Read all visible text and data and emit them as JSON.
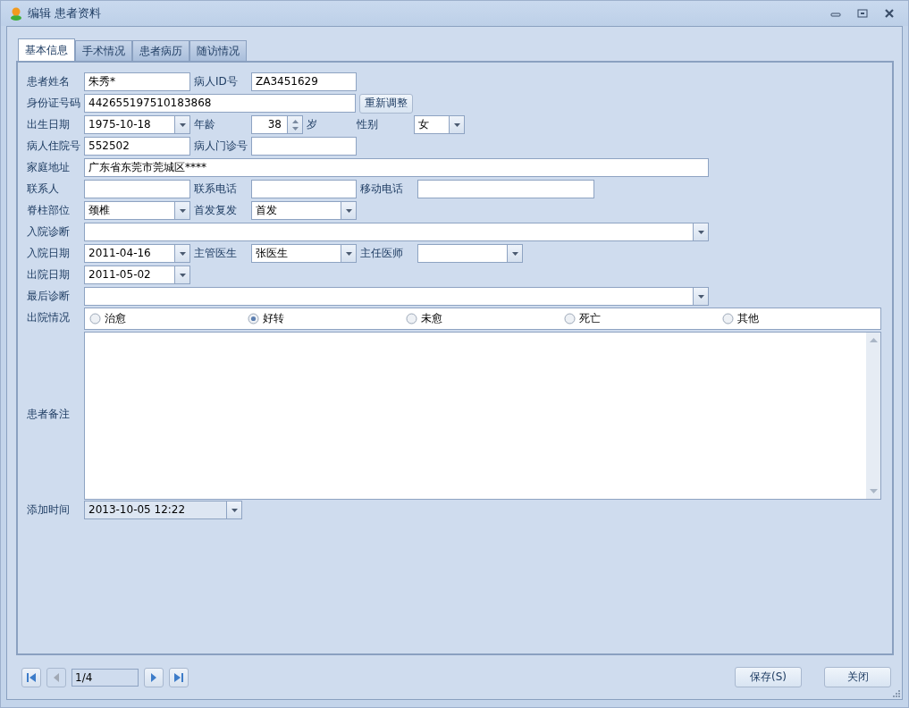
{
  "window": {
    "title": "编辑 患者资料"
  },
  "tabs": [
    {
      "label": "基本信息",
      "selected": true
    },
    {
      "label": "手术情况",
      "selected": false
    },
    {
      "label": "患者病历",
      "selected": false
    },
    {
      "label": "随访情况",
      "selected": false
    }
  ],
  "form": {
    "rows": [
      {
        "fields": [
          {
            "label": "患者姓名",
            "kind": "text",
            "value": "朱秀*"
          },
          {
            "label": "病人ID号",
            "kind": "text",
            "value": "ZA3451629"
          }
        ]
      },
      {
        "fields": [
          {
            "label": "身份证号码",
            "kind": "text",
            "value": "442655197510183868"
          },
          {
            "kind": "button",
            "value": "重新调整"
          }
        ]
      },
      {
        "fields": [
          {
            "label": "出生日期",
            "kind": "combo",
            "value": "1975-10-18"
          },
          {
            "label": "年龄",
            "kind": "spin",
            "value": "38",
            "unit": "岁"
          },
          {
            "label": "性别",
            "kind": "combo",
            "value": "女"
          }
        ]
      },
      {
        "fields": [
          {
            "label": "病人住院号",
            "kind": "text",
            "value": "552502"
          },
          {
            "label": "病人门诊号",
            "kind": "text"
          }
        ]
      },
      {
        "fields": [
          {
            "label": "家庭地址",
            "kind": "text",
            "value": "广东省东莞市莞城区****"
          }
        ]
      },
      {
        "fields": [
          {
            "label": "联系人",
            "kind": "text"
          },
          {
            "label": "联系电话",
            "kind": "text"
          },
          {
            "label": "移动电话",
            "kind": "text"
          }
        ]
      },
      {
        "fields": [
          {
            "label": "脊柱部位",
            "kind": "combo",
            "value": "颈椎"
          },
          {
            "label": "首发复发",
            "kind": "combo",
            "value": "首发"
          }
        ]
      },
      {
        "fields": [
          {
            "label": "入院诊断",
            "kind": "combo"
          }
        ]
      },
      {
        "fields": [
          {
            "label": "入院日期",
            "kind": "combo",
            "value": "2011-04-16"
          },
          {
            "label": "主管医生",
            "kind": "combo",
            "value": "张医生"
          },
          {
            "label": "主任医师",
            "kind": "combo"
          }
        ]
      },
      {
        "fields": [
          {
            "label": "出院日期",
            "kind": "combo",
            "value": "2011-05-02"
          }
        ]
      },
      {
        "fields": [
          {
            "label": "最后诊断",
            "kind": "combo"
          }
        ]
      },
      {
        "fields": [
          {
            "label": "出院情况",
            "kind": "radio",
            "options": [
              {
                "label": "治愈",
                "selected": false
              },
              {
                "label": "好转",
                "selected": true
              },
              {
                "label": "未愈",
                "selected": false
              },
              {
                "label": "死亡",
                "selected": false
              },
              {
                "label": "其他",
                "selected": false
              }
            ]
          }
        ]
      },
      {
        "fields": [
          {
            "label": "患者备注",
            "kind": "memo"
          }
        ]
      },
      {
        "fields": [
          {
            "label": "添加时间",
            "kind": "combo",
            "value": "2013-10-05 12:22",
            "readonly": true
          }
        ]
      }
    ]
  },
  "pager": {
    "position": "1/4",
    "buttons": [
      {
        "kind": "first",
        "disabled": false
      },
      {
        "kind": "prev",
        "disabled": true
      },
      {
        "kind": "next",
        "disabled": false
      },
      {
        "kind": "last",
        "disabled": false
      }
    ]
  },
  "buttons": [
    "保存(S)",
    "关闭"
  ]
}
